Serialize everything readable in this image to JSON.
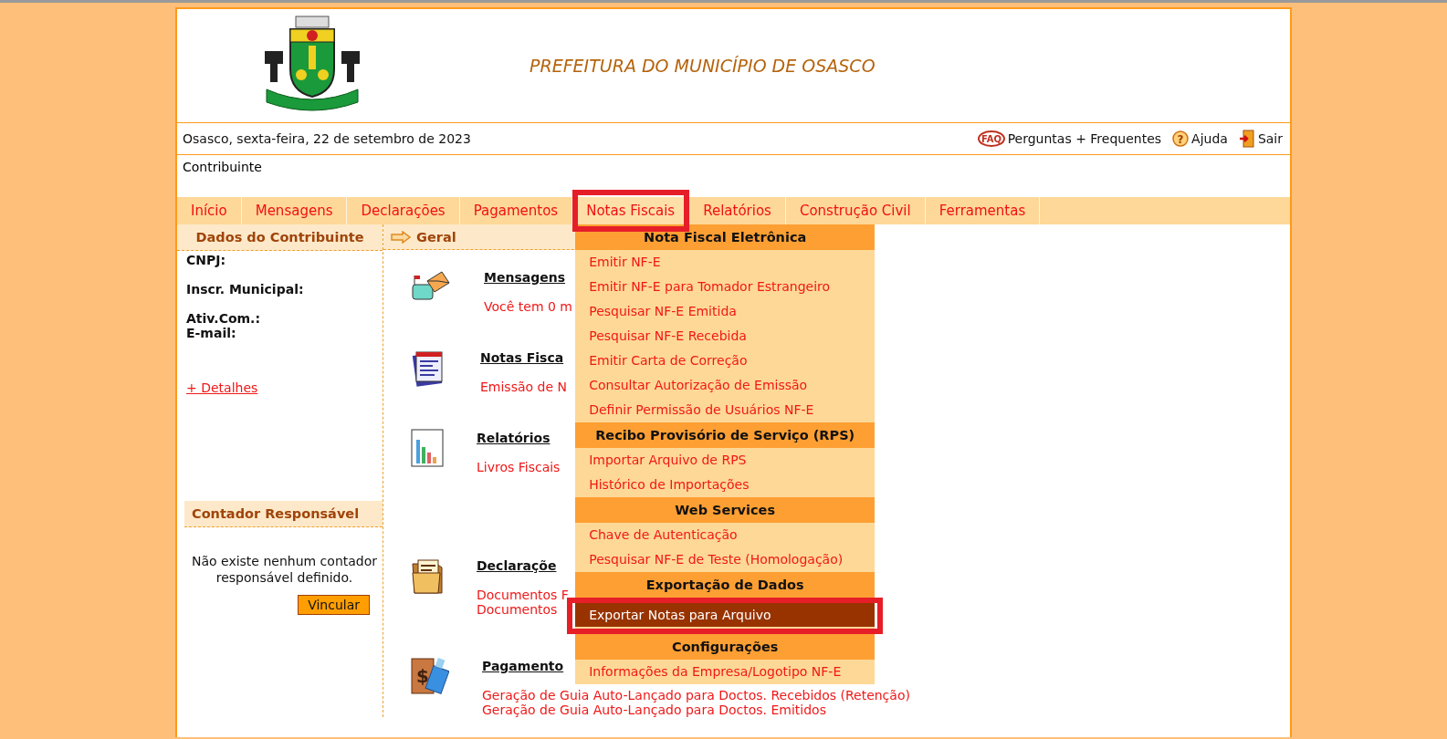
{
  "header": {
    "title": "PREFEITURA DO MUNICÍPIO DE OSASCO"
  },
  "top_bar": {
    "date": "Osasco, sexta-feira, 22 de setembro de 2023",
    "links": [
      {
        "kind": "faq",
        "icon_text": "FAQ",
        "label": "Perguntas + Frequentes"
      },
      {
        "kind": "help",
        "icon_text": "?",
        "label": "Ajuda"
      },
      {
        "kind": "exit",
        "label": "Sair"
      }
    ]
  },
  "user_type": "Contribuinte",
  "nav": [
    {
      "label": "Início",
      "selected": false,
      "annotated": false
    },
    {
      "label": "Mensagens",
      "selected": false,
      "annotated": false
    },
    {
      "label": "Declarações",
      "selected": false,
      "annotated": false
    },
    {
      "label": "Pagamentos",
      "selected": false,
      "annotated": false
    },
    {
      "label": "Notas Fiscais",
      "selected": true,
      "annotated": true
    },
    {
      "label": "Relatórios",
      "selected": false,
      "annotated": false
    },
    {
      "label": "Construção Civil",
      "selected": false,
      "annotated": false
    },
    {
      "label": "Ferramentas",
      "selected": false,
      "annotated": false
    }
  ],
  "sidebar": {
    "title": "Dados do Contribuinte",
    "fields": [
      "CNPJ:",
      "Inscr. Municipal:",
      "Ativ.Com.:",
      "E-mail:"
    ],
    "details_link": "+ Detalhes",
    "accountant": {
      "title": "Contador Responsável",
      "message": "Não existe nenhum contador responsável definido.",
      "button": "Vincular"
    }
  },
  "main": {
    "title": "Geral",
    "sections": [
      {
        "kind": "mail",
        "title": "Mensagens",
        "lines": [
          "Você tem 0 m"
        ]
      },
      {
        "kind": "notes",
        "title": "Notas Fisca",
        "lines": [
          "Emissão de N"
        ]
      },
      {
        "kind": "reports",
        "title": "Relatórios",
        "lines": [
          "Livros Fiscais"
        ]
      },
      {
        "kind": "declarations",
        "title": "Declaraçõe",
        "lines": [
          "Documentos F",
          "Documentos"
        ]
      },
      {
        "kind": "payments",
        "icon_text": "$",
        "title": "Pagamento",
        "lines": [
          "Geração de Guia Auto-Lançado para Doctos. Recebidos (Retenção)",
          "Geração de Guia Auto-Lançado para Doctos. Emitidos"
        ]
      }
    ]
  },
  "dropdown": {
    "groups": [
      {
        "title": "Nota Fiscal Eletrônica",
        "items": [
          {
            "label": "Emitir NF-E",
            "selected": false,
            "annotated": false
          },
          {
            "label": "Emitir NF-E para Tomador Estrangeiro",
            "selected": false,
            "annotated": false
          },
          {
            "label": "Pesquisar NF-E Emitida",
            "selected": false,
            "annotated": false
          },
          {
            "label": "Pesquisar NF-E Recebida",
            "selected": false,
            "annotated": false
          },
          {
            "label": "Emitir Carta de Correção",
            "selected": false,
            "annotated": false
          },
          {
            "label": "Consultar Autorização de Emissão",
            "selected": false,
            "annotated": false
          },
          {
            "label": "Definir Permissão de Usuários NF-E",
            "selected": false,
            "annotated": false
          }
        ]
      },
      {
        "title": "Recibo Provisório de Serviço (RPS)",
        "items": [
          {
            "label": "Importar Arquivo de RPS",
            "selected": false,
            "annotated": false
          },
          {
            "label": "Histórico de Importações",
            "selected": false,
            "annotated": false
          }
        ]
      },
      {
        "title": "Web Services",
        "items": [
          {
            "label": "Chave de Autenticação",
            "selected": false,
            "annotated": false
          },
          {
            "label": "Pesquisar NF-E de Teste (Homologação)",
            "selected": false,
            "annotated": false
          }
        ]
      },
      {
        "title": "Exportação de Dados",
        "items": [
          {
            "label": "Exportar Notas para Arquivo",
            "selected": true,
            "annotated": true
          }
        ]
      },
      {
        "title": "Configurações",
        "items": [
          {
            "label": "Informações da Empresa/Logotipo NF-E",
            "selected": false,
            "annotated": false
          }
        ]
      }
    ]
  }
}
